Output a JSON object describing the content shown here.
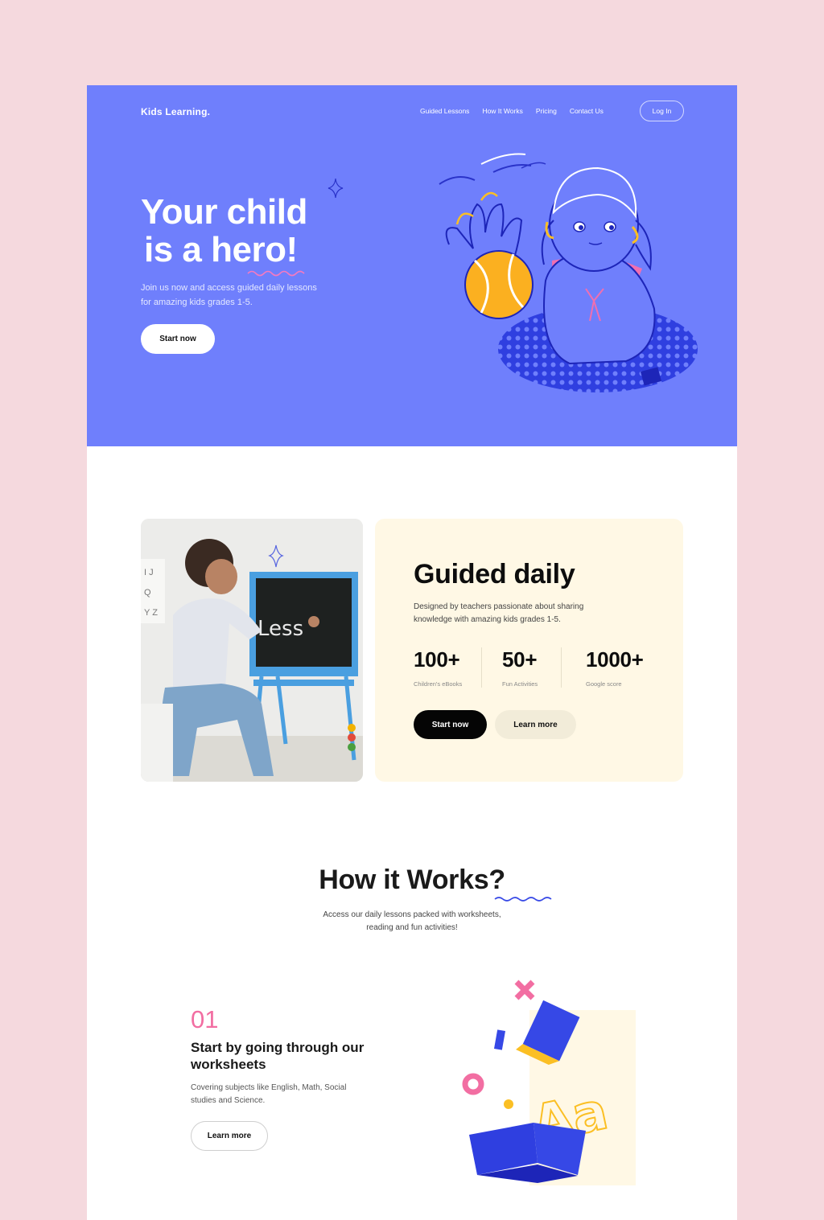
{
  "header": {
    "brand": "Kids Learning.",
    "nav": [
      "Guided Lessons",
      "How It Works",
      "Pricing",
      "Contact Us"
    ],
    "login_label": "Log In"
  },
  "hero": {
    "title_line1": "Your child",
    "title_line2": "is a hero!",
    "subtitle": "Join us now and access guided daily lessons for  amazing kids grades 1-5.",
    "cta_label": "Start now"
  },
  "guided": {
    "photo_chalk_text": "Less",
    "title": "Guided daily",
    "subtitle": "Designed by teachers passionate about sharing knowledge with amazing kids grades 1-5.",
    "stats": [
      {
        "value": "100+",
        "label": "Children's  eBooks"
      },
      {
        "value": "50+",
        "label": "Fun Activities"
      },
      {
        "value": "1000+",
        "label": "Google score"
      }
    ],
    "primary_label": "Start now",
    "secondary_label": "Learn more"
  },
  "how": {
    "title": "How it Works?",
    "subtitle": "Access our daily lessons packed with worksheets, reading and fun activities!",
    "step": {
      "number": "01",
      "title": "Start by going through our worksheets",
      "description": "Covering subjects like English, Math, Social studies and Science.",
      "button_label": "Learn more"
    }
  },
  "colors": {
    "page_background": "#f5d9de",
    "hero_background": "#6f7ffc",
    "card_background": "#fff8e5",
    "accent_pink": "#f26ea2",
    "accent_yellow": "#fbbf24",
    "accent_blue": "#2f3fe0"
  }
}
